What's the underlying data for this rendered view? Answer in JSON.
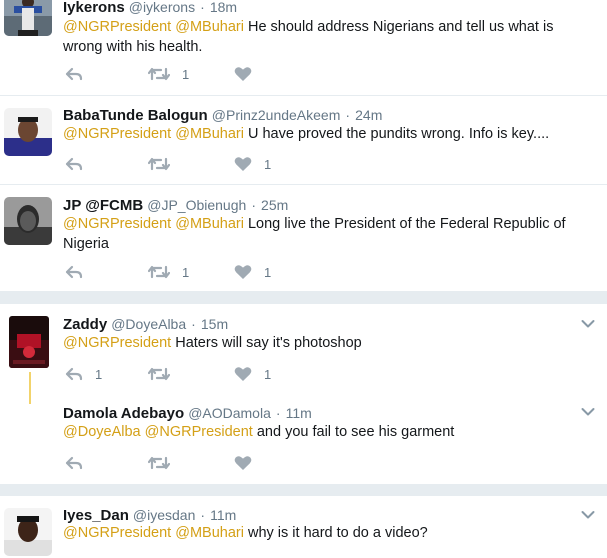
{
  "tweets": [
    {
      "name": "Iykerons",
      "handle": "@iykerons",
      "dot": "·",
      "time": "18m",
      "text": [
        {
          "m": "@NGRPresident"
        },
        {
          "t": " "
        },
        {
          "m": "@MBuhari"
        },
        {
          "t": "  He should address Nigerians and tell us what is wrong with his health."
        }
      ],
      "reply_count": "",
      "retweet_count": "1",
      "like_count": ""
    },
    {
      "name": "BabaTunde Balogun",
      "handle": "@Prinz2undeAkeem",
      "dot": "·",
      "time": "24m",
      "text": [
        {
          "m": "@NGRPresident"
        },
        {
          "t": " "
        },
        {
          "m": "@MBuhari"
        },
        {
          "t": " U have proved the pundits wrong. Info is key...."
        }
      ],
      "reply_count": "",
      "retweet_count": "",
      "like_count": "1"
    },
    {
      "name": "JP @FCMB",
      "handle": "@JP_Obienugh",
      "dot": "·",
      "time": "25m",
      "text": [
        {
          "m": "@NGRPresident"
        },
        {
          "t": " "
        },
        {
          "m": "@MBuhari"
        },
        {
          "t": " Long live the President of the Federal Republic of Nigeria"
        }
      ],
      "reply_count": "",
      "retweet_count": "1",
      "like_count": "1"
    },
    {
      "name": "Zaddy",
      "handle": "@DoyeAlba",
      "dot": "·",
      "time": "15m",
      "text": [
        {
          "m": "@NGRPresident"
        },
        {
          "t": " Haters will say it's photoshop"
        }
      ],
      "reply_count": "1",
      "retweet_count": "",
      "like_count": "1"
    },
    {
      "name": "Damola Adebayo",
      "handle": "@AODamola",
      "dot": "·",
      "time": "11m",
      "text": [
        {
          "m": "@DoyeAlba"
        },
        {
          "t": " "
        },
        {
          "m": "@NGRPresident"
        },
        {
          "t": " and you fail to see his garment"
        }
      ],
      "reply_count": "",
      "retweet_count": "",
      "like_count": ""
    },
    {
      "name": "Iyes_Dan",
      "handle": "@iyesdan",
      "dot": "·",
      "time": "11m",
      "text": [
        {
          "m": "@NGRPresident"
        },
        {
          "t": " "
        },
        {
          "m": "@MBuhari"
        },
        {
          "t": " why is it hard to do a video?"
        }
      ],
      "reply_count": "",
      "retweet_count": "",
      "like_count": ""
    }
  ],
  "icons": {
    "reply": "reply-icon",
    "retweet": "retweet-icon",
    "like": "heart-icon",
    "more": "chevron-down-icon"
  },
  "colors": {
    "mention": "#d4a017",
    "meta": "#657786",
    "icon": "#a0aab3",
    "separator": "#e6ecf0",
    "thread_line": "#f2d36b"
  }
}
